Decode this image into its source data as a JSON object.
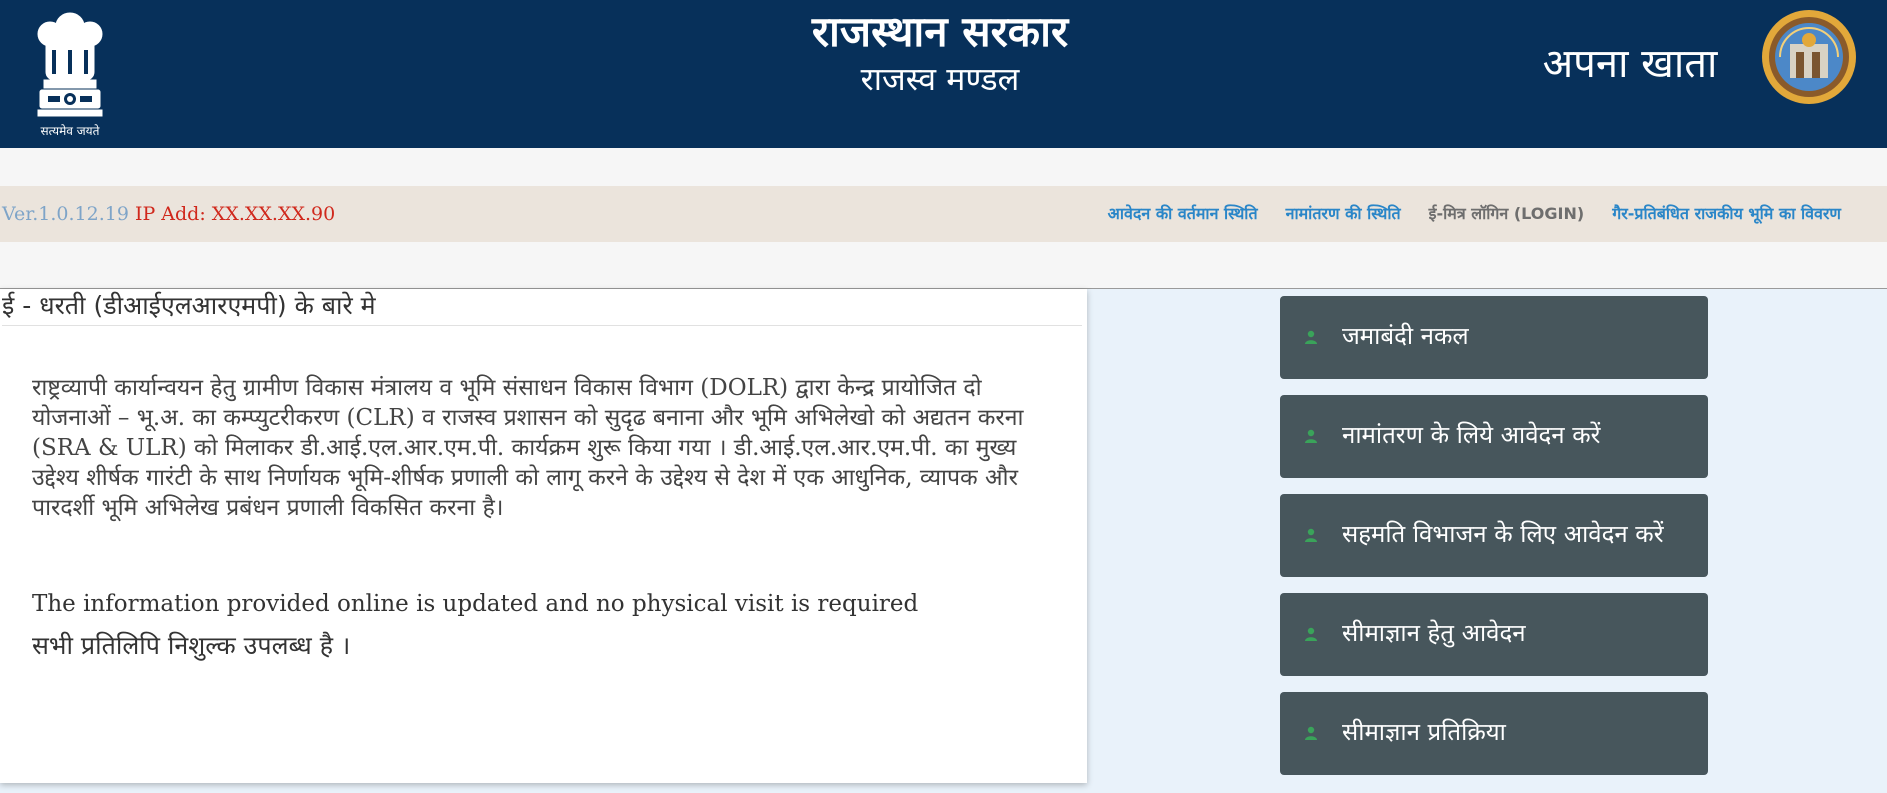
{
  "header": {
    "emblem_motto": "सत्यमेव जयते",
    "title": "राजस्थान सरकार",
    "subtitle": "राजस्व मण्डल",
    "app_name": "अपना खाता"
  },
  "navbar": {
    "version": "Ver.1.0.12.19",
    "ip_address": "IP Add: XX.XX.XX.90",
    "links": [
      {
        "label": "आवेदन की वर्तमान स्थिति"
      },
      {
        "label": "नामांतरण की स्थिति"
      },
      {
        "label": "ई-मित्र लॉगिन (LOGIN)"
      },
      {
        "label": "गैर-प्रतिबंधित राजकीय भूमि का विवरण"
      }
    ]
  },
  "about": {
    "title": "ई - धरती (डीआईएलआरएमपी) के बारे मे",
    "body": "राष्ट्रव्यापी कार्यान्वयन हेतु ग्रामीण विकास मंत्रालय व भूमि संसाधन विकास विभाग (DOLR) द्वारा केन्द्र प्रायोजित दो योजनाओं – भू.अ. का कम्प्युटरीकरण (CLR) व राजस्व प्रशासन को सुदृढ बनाना और भूमि अभिलेखो को अद्यतन करना (SRA & ULR) को मिलाकर डी.आई.एल.आर.एम.पी. कार्यक्रम शुरू किया गया । डी.आई.एल.आर.एम.पी. का मुख्य उद्देश्य शीर्षक गारंटी के साथ निर्णायक भूमि-शीर्षक प्रणाली को लागू करने के उद्देश्य से देश में एक आधुनिक, व्यापक और पारदर्शी भूमि अभिलेख प्रबंधन प्रणाली विकसित करना है।",
    "english_note": "The information provided online is updated and no physical visit is required",
    "free_note": "सभी प्रतिलिपि निशुल्क उपलब्ध है ।"
  },
  "services": [
    {
      "label": "जमाबंदी नकल",
      "icon": "user-icon"
    },
    {
      "label": "नामांतरण के लिये आवेदन करें",
      "icon": "user-icon"
    },
    {
      "label": "सहमति विभाजन के लिए आवेदन करें",
      "icon": "user-icon"
    },
    {
      "label": "सीमाज्ञान हेतु आवेदन",
      "icon": "user-icon"
    },
    {
      "label": "सीमाज्ञान प्रतिक्रिया",
      "icon": "user-icon"
    }
  ],
  "colors": {
    "header_bg": "#07305a",
    "nav_bg": "#ebe4dc",
    "link_blue": "#2a86c8",
    "ip_red": "#d0281c",
    "button_bg": "#47565c",
    "icon_green": "#3aa35a"
  }
}
